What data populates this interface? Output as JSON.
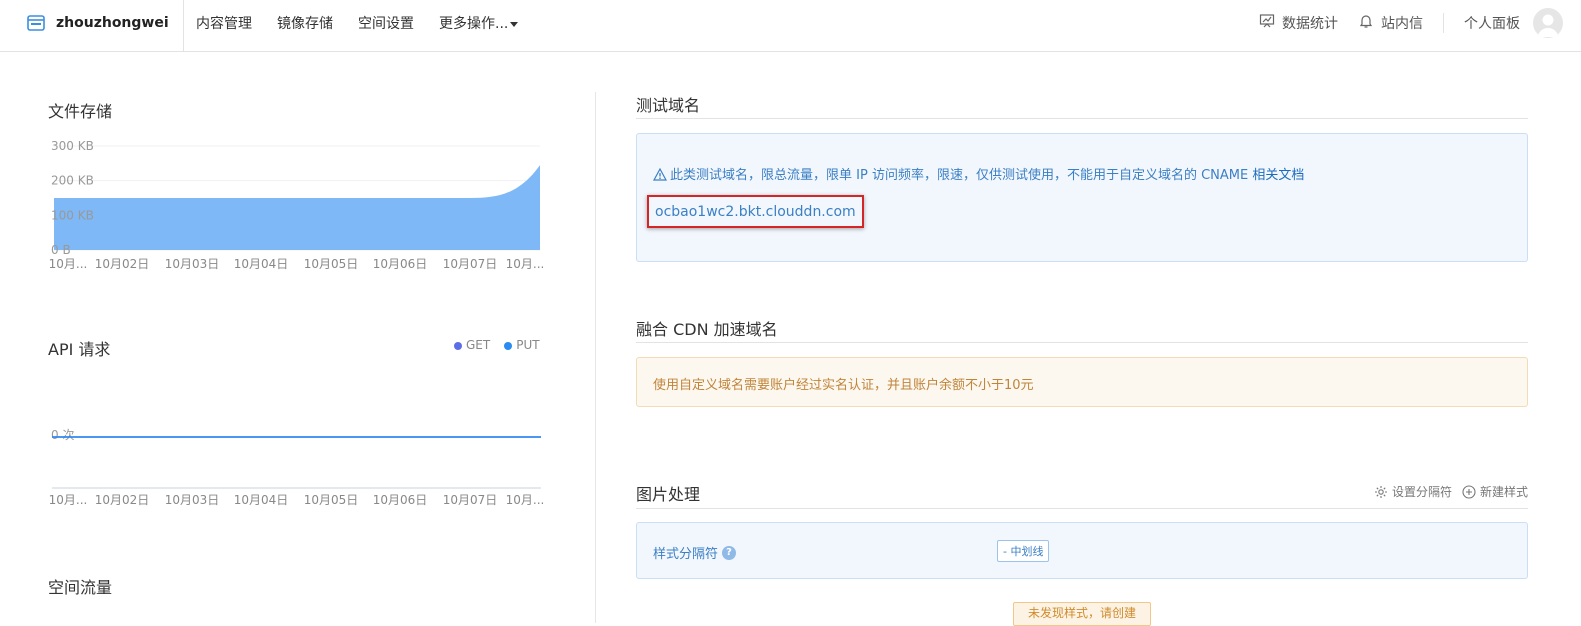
{
  "brand": {
    "name": "zhouzhongwei",
    "icon": "bucket-icon"
  },
  "nav": {
    "items": [
      "内容管理",
      "镜像存储",
      "空间设置",
      "更多操作..."
    ]
  },
  "right_nav": {
    "stats": "数据统计",
    "messages": "站内信",
    "panel": "个人面板"
  },
  "storage": {
    "title": "文件存储",
    "chart_data": {
      "type": "area",
      "title": "文件存储",
      "y_ticks": [
        "300 KB",
        "200 KB",
        "100 KB",
        "0 B"
      ],
      "ylim": [
        0,
        300
      ],
      "x_ticks": [
        "10月...",
        "10月02日",
        "10月03日",
        "10月04日",
        "10月05日",
        "10月06日",
        "10月07日",
        "10月..."
      ],
      "values": [
        150,
        150,
        150,
        150,
        150,
        150,
        150,
        245
      ],
      "color": "#7eb8f6"
    }
  },
  "api": {
    "title": "API 请求",
    "legend": [
      {
        "name": "GET",
        "color": "#5b6ee8"
      },
      {
        "name": "PUT",
        "color": "#2a8bf2"
      }
    ],
    "chart_data": {
      "type": "line",
      "title": "API 请求",
      "y_ticks": [
        "0 次"
      ],
      "x_ticks": [
        "10月...",
        "10月02日",
        "10月03日",
        "10月04日",
        "10月05日",
        "10月06日",
        "10月07日",
        "10月..."
      ],
      "series": [
        {
          "name": "GET",
          "values": [
            0,
            0,
            0,
            0,
            0,
            0,
            0,
            0
          ]
        },
        {
          "name": "PUT",
          "values": [
            0,
            0,
            0,
            0,
            0,
            0,
            0,
            0
          ]
        }
      ]
    }
  },
  "traffic": {
    "title": "空间流量"
  },
  "test_domain": {
    "title": "测试域名",
    "notice": "此类测试域名，限总流量，限单 IP 访问频率，限速，仅供测试使用，不能用于自定义域名的 CNAME",
    "doc_link": "相关文档",
    "domain": "ocbao1wc2.bkt.clouddn.com"
  },
  "cdn": {
    "title": "融合 CDN 加速域名",
    "warning": "使用自定义域名需要账户经过实名认证，并且账户余额不小于10元"
  },
  "image": {
    "title": "图片处理",
    "set_separator": "设置分隔符",
    "new_style": "新建样式",
    "separator_label": "样式分隔符",
    "separator_value": "- 中划线",
    "empty_notice": "未发现样式，请创建"
  },
  "colors": {
    "accent": "#3b7fc4",
    "area_fill": "#7eb8f6",
    "highlight_border": "#d42626",
    "warning_text": "#c0843a"
  }
}
